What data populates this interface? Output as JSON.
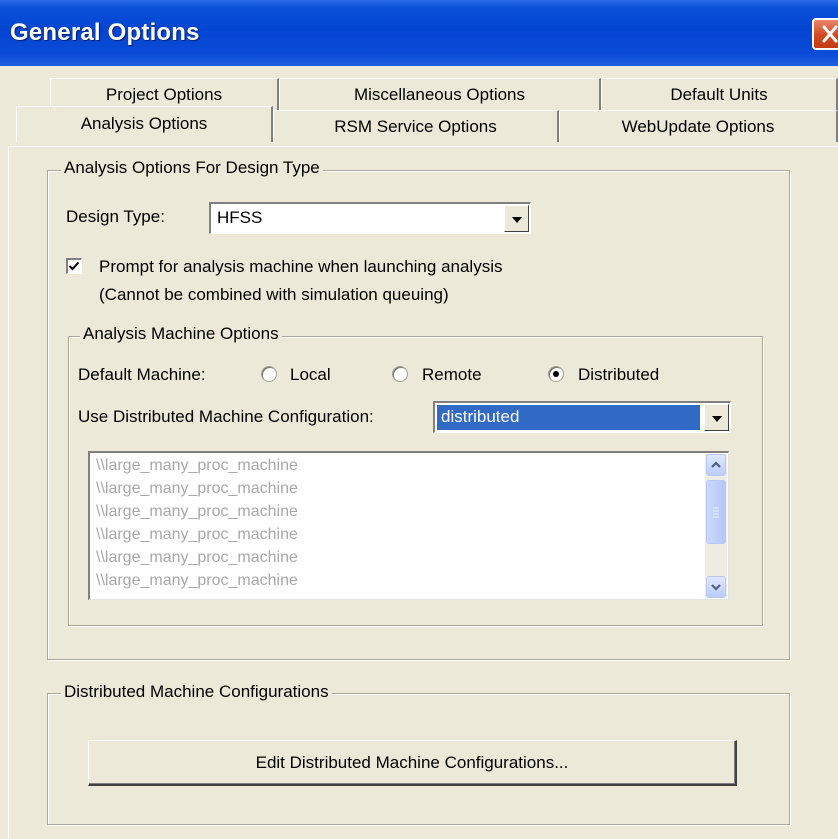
{
  "window": {
    "title": "General Options"
  },
  "tabs": {
    "row1": [
      "Project Options",
      "Miscellaneous Options",
      "Default Units"
    ],
    "row2": [
      "Analysis Options",
      "RSM Service Options",
      "WebUpdate Options"
    ],
    "active": "Analysis Options"
  },
  "analysis_group": {
    "legend": "Analysis Options For Design Type",
    "design_type_label": "Design Type:",
    "design_type_value": "HFSS",
    "prompt_checkbox": {
      "checked": true,
      "line1": "Prompt for analysis machine when launching analysis",
      "line2": "(Cannot be combined with simulation queuing)"
    }
  },
  "machine_group": {
    "legend": "Analysis Machine Options",
    "default_machine_label": "Default Machine:",
    "radios": [
      {
        "label": "Local",
        "selected": false
      },
      {
        "label": "Remote",
        "selected": false
      },
      {
        "label": "Distributed",
        "selected": true
      }
    ],
    "config_label": "Use Distributed Machine Configuration:",
    "config_value": "distributed",
    "machine_list": [
      "\\\\large_many_proc_machine",
      "\\\\large_many_proc_machine",
      "\\\\large_many_proc_machine",
      "\\\\large_many_proc_machine",
      "\\\\large_many_proc_machine",
      "\\\\large_many_proc_machine"
    ]
  },
  "distributed_group": {
    "legend": "Distributed Machine Configurations",
    "edit_button": "Edit Distributed Machine Configurations..."
  },
  "colors": {
    "titlebar": "#0245d2",
    "selection": "#316ac5",
    "dialog_bg": "#ece9d8"
  },
  "icons": {
    "close": "close-icon",
    "dropdown": "chevron-down-icon",
    "scroll_up": "scroll-up-icon",
    "scroll_down": "scroll-down-icon"
  }
}
